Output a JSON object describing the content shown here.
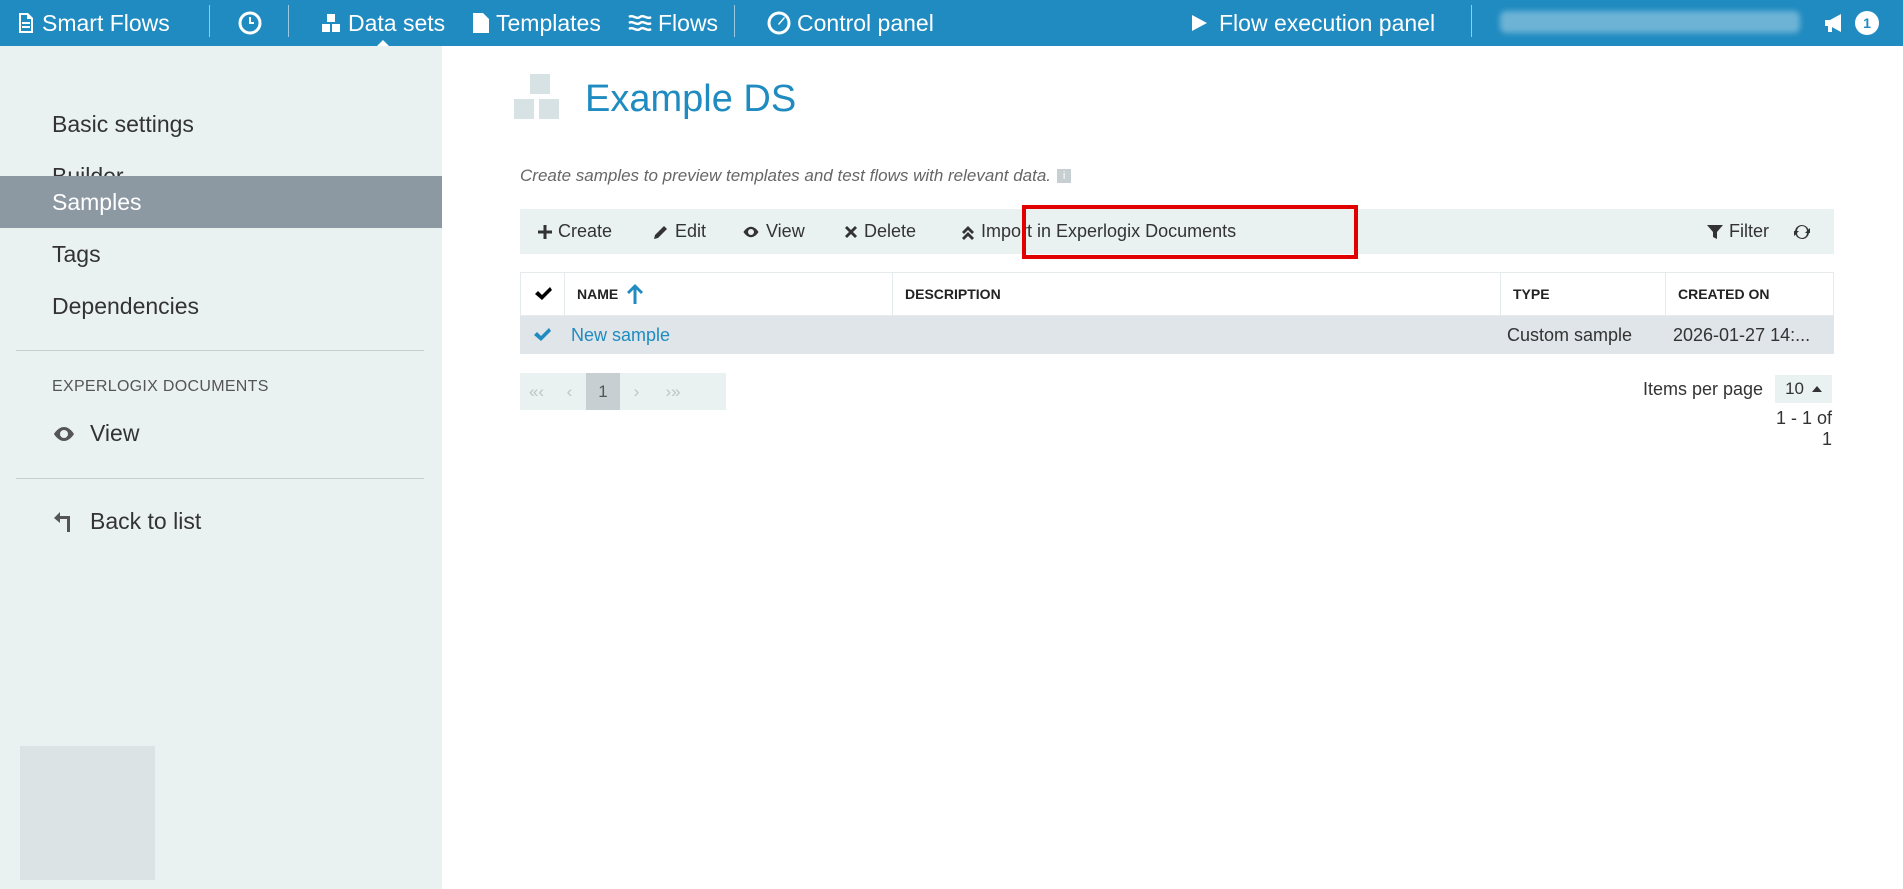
{
  "topbar": {
    "brand": "Smart Flows",
    "datasets": "Data sets",
    "templates": "Templates",
    "flows": "Flows",
    "control_panel": "Control panel",
    "flow_execution": "Flow execution panel",
    "notifications_count": "1"
  },
  "sidebar": {
    "items": [
      {
        "label": "Basic settings"
      },
      {
        "label": "Builder"
      },
      {
        "label": "Samples"
      },
      {
        "label": "Tags"
      },
      {
        "label": "Dependencies"
      }
    ],
    "section_title": "EXPERLOGIX DOCUMENTS",
    "view_label": "View",
    "back_label": "Back to list"
  },
  "page": {
    "title": "Example DS",
    "hint": "Create samples to preview templates and test flows with relevant data."
  },
  "toolbar": {
    "create": "Create",
    "edit": "Edit",
    "view": "View",
    "delete": "Delete",
    "import": "Import in Experlogix Documents",
    "filter": "Filter"
  },
  "grid": {
    "columns": [
      "NAME",
      "DESCRIPTION",
      "TYPE",
      "CREATED ON"
    ],
    "rows": [
      {
        "name": "New sample",
        "description": "",
        "type": "Custom sample",
        "created_on": "2026-01-27 14:..."
      }
    ]
  },
  "pager": {
    "first": "«‹",
    "prev": "‹",
    "current": "1",
    "next": "›",
    "last": "›»",
    "items_per_page_label": "Items per page",
    "items_per_page_value": "10",
    "range": "1 - 1 of 1"
  },
  "colors": {
    "topbar": "#1f8bc0",
    "sidebar": "#eaf1f1",
    "active_item": "#8c98a2",
    "highlight": "#e00000"
  }
}
